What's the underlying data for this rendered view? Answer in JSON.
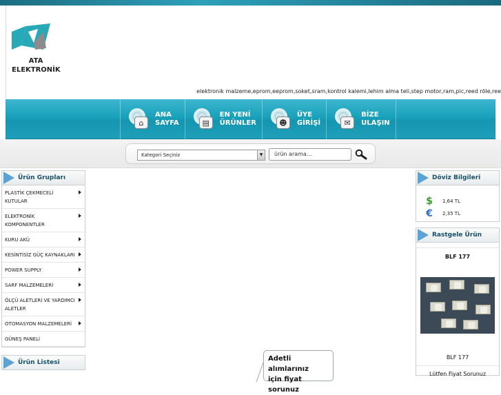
{
  "brand": {
    "logo_alt": "ATA ELEKTRONİK logo",
    "name_line1": "ATA",
    "name_line2": "ELEKTRONİK",
    "colors": {
      "accent": "#1aa1bb",
      "logo_teal": "#27a9b8",
      "logo_grey": "#8c8c8c"
    }
  },
  "tagline": "elektronik malzeme,eprom,eeprom,soket,sram,kontrol kalemi,lehim alma teli,step motor,ram,pic,reed röle,ree",
  "nav": [
    {
      "line1": "ANA",
      "line2": "SAYFA",
      "icon": "home-icon"
    },
    {
      "line1": "EN YENİ",
      "line2": "ÜRÜNLER",
      "icon": "new-products-icon"
    },
    {
      "line1": "ÜYE",
      "line2": "GİRİŞİ",
      "icon": "users-icon"
    },
    {
      "line1": "BİZE",
      "line2": "ULAŞIN",
      "icon": "mail-icon"
    }
  ],
  "search": {
    "category_selected": "Kategori Seçiniz",
    "placeholder": "ürün arama..."
  },
  "left": {
    "groups_title": "Ürün Grupları",
    "categories": [
      {
        "label": "PLASTİK ÇEKMECELİ KUTULAR",
        "has_sub": true
      },
      {
        "label": "ELEKTRONİK KOMPONENTLER",
        "has_sub": true
      },
      {
        "label": "KURU AKÜ",
        "has_sub": true
      },
      {
        "label": "KESİNTİSİZ GÜÇ KAYNAKLARI",
        "has_sub": true
      },
      {
        "label": "POWER SUPPLY",
        "has_sub": true
      },
      {
        "label": "SARF MALZEMELERİ",
        "has_sub": true
      },
      {
        "label": "ÖLÇÜ ALETLERİ VE YARDIMCI ALETLER",
        "has_sub": true
      },
      {
        "label": "OTOMASYON MALZEMELERİ",
        "has_sub": true
      },
      {
        "label": "GÜNEŞ PANELİ",
        "has_sub": false
      }
    ],
    "list_title": "Ürün Listesi"
  },
  "right": {
    "fx_title": "Döviz Bilgileri",
    "fx": [
      {
        "symbol": "$",
        "value": "1,64 TL",
        "icon": "dollar-icon",
        "color": "#3a9a2a"
      },
      {
        "symbol": "€",
        "value": "2,35 TL",
        "icon": "euro-icon",
        "color": "#2a73c9"
      }
    ],
    "random_title": "Rastgele Ürün",
    "product_title": "BLF 177",
    "product_caption": "BLF 177",
    "price_note": "Lütfen Fiyat Sorunuz"
  },
  "bubble": {
    "line1": "Adetli alımlarınız",
    "line2": "için fiyat sorunuz"
  }
}
